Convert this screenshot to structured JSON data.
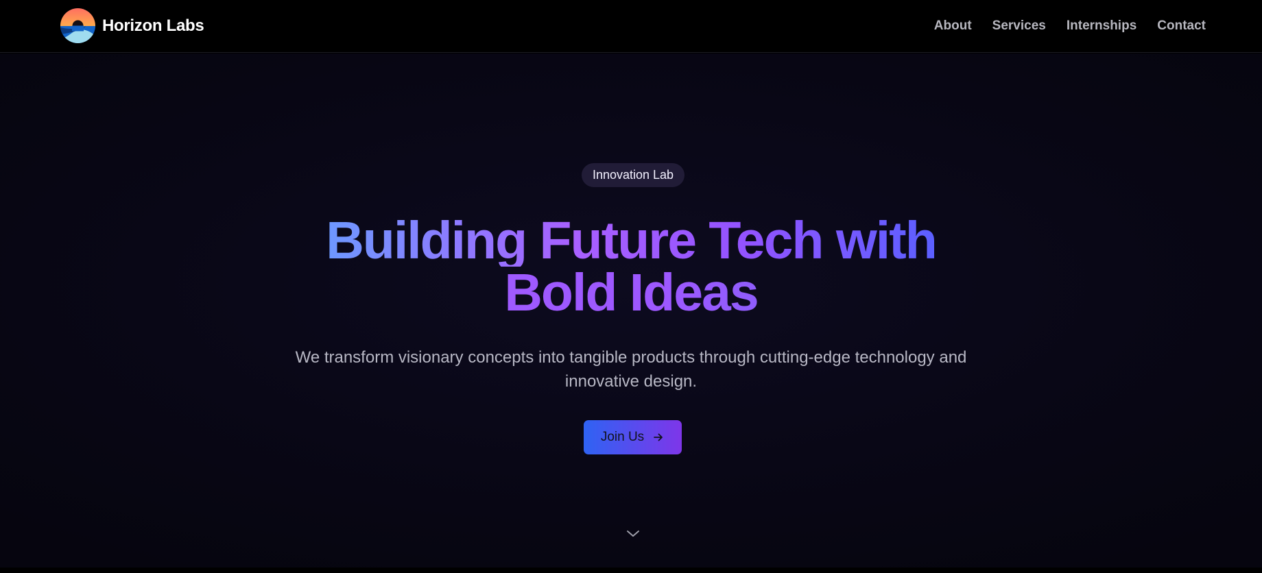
{
  "brand": {
    "name": "Horizon Labs",
    "logo_icon": "horizon-sunset-logo"
  },
  "navigation": {
    "links": [
      "About",
      "Services",
      "Internships",
      "Contact"
    ]
  },
  "hero": {
    "badge": "Innovation Lab",
    "headline_line_1": "Building Future Tech with",
    "headline_line_2": "Bold Ideas",
    "subtitle": "We transform visionary concepts into tangible products through cutting-edge technology and innovative design.",
    "cta_label": "Join Us",
    "cta_icon": "arrow-right-icon",
    "scroll_icon": "chevron-down-icon"
  },
  "colors": {
    "background": "#090716",
    "accent_blue": "#2f63f3",
    "accent_purple": "#7e36e9",
    "headline_blue": "#61a4ff",
    "headline_purple": "#a960ff"
  }
}
